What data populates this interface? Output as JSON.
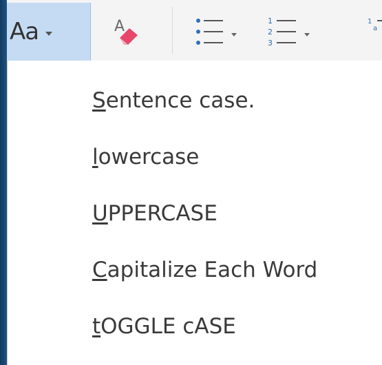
{
  "toolbar": {
    "change_case_label": "Aa",
    "buttons": [
      {
        "name": "change-case",
        "icon": "aa-icon"
      },
      {
        "name": "clear-formatting",
        "icon": "eraser-icon"
      },
      {
        "name": "bullets",
        "icon": "bullet-list-icon"
      },
      {
        "name": "numbering",
        "icon": "numbered-list-icon"
      },
      {
        "name": "multilevel-list",
        "icon": "multilevel-list-icon"
      }
    ]
  },
  "menu": {
    "items": [
      {
        "accel": "S",
        "rest": "entence case."
      },
      {
        "accel": "l",
        "rest": "owercase"
      },
      {
        "accel": "U",
        "rest": "PPERCASE"
      },
      {
        "accel": "C",
        "rest": "apitalize Each Word"
      },
      {
        "accel": "t",
        "rest": "OGGLE cASE"
      }
    ]
  },
  "colors": {
    "window_frame": "#1c4a72",
    "selected_button": "#c5dbf3",
    "eraser_pink": "#e8476a",
    "list_blue": "#2f6fb5"
  }
}
